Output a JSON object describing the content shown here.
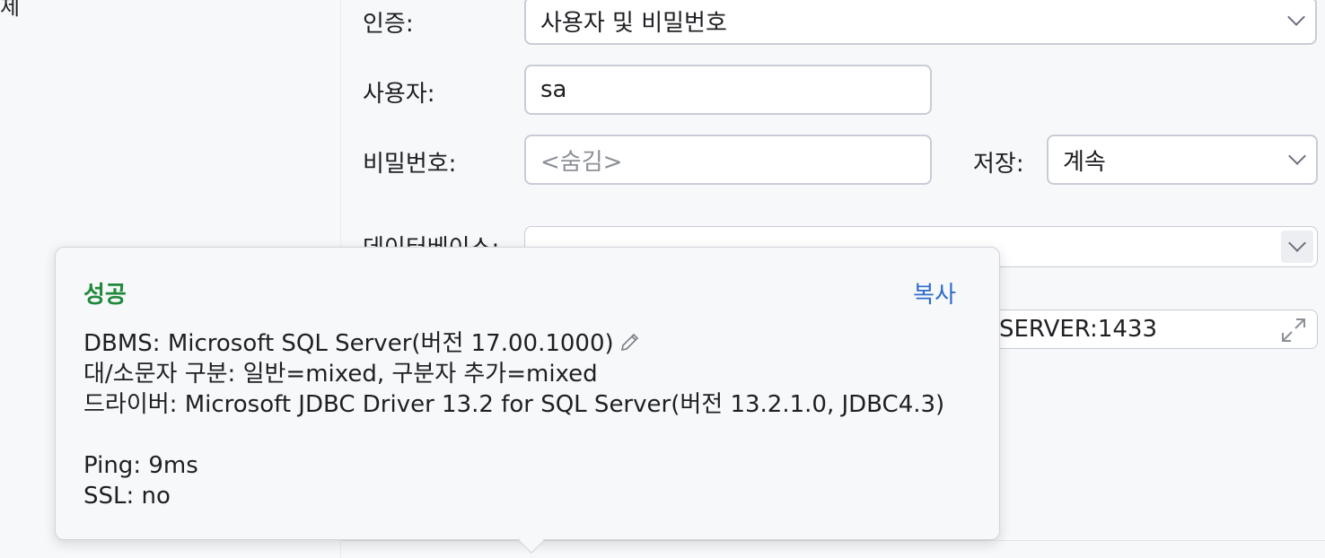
{
  "left_panel": {
    "stub_text": "제"
  },
  "form": {
    "auth_label": "인증:",
    "auth_value": "사용자 및 비밀번호",
    "user_label": "사용자:",
    "user_value": "sa",
    "password_label": "비밀번호:",
    "password_placeholder": "<숨김>",
    "save_label": "저장:",
    "save_value": "계속",
    "database_label": "데이터베이스:",
    "database_value": "",
    "url_value_visible": "SERVER:1433"
  },
  "popup": {
    "title": "성공",
    "copy_label": "복사",
    "lines": [
      "DBMS: Microsoft SQL Server(버전 17.00.1000)",
      "대/소문자 구분: 일반=mixed, 구분자 추가=mixed",
      "드라이버: Microsoft JDBC Driver 13.2 for SQL Server(버전 13.2.1.0, JDBC4.3)",
      "",
      "Ping: 9ms",
      "SSL: no"
    ]
  },
  "colors": {
    "success": "#208a3c",
    "link": "#2f6ccc",
    "field_border": "#c9ccd6"
  },
  "icons": [
    "chevron-down-icon",
    "expand-icon",
    "pencil-icon"
  ]
}
